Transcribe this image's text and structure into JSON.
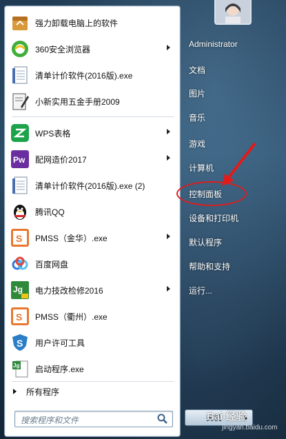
{
  "programs": [
    {
      "label": "强力卸载电脑上的软件",
      "icon": "uninstaller-box-icon",
      "submenu": false
    },
    {
      "label": "360安全浏览器",
      "icon": "360-browser-icon",
      "submenu": true
    },
    {
      "label": "清单计价软件(2016版).exe",
      "icon": "document-exe-icon",
      "submenu": false
    },
    {
      "label": "小新实用五金手册2009",
      "icon": "notebook-pen-icon",
      "submenu": false
    },
    {
      "label": "WPS表格",
      "icon": "wps-spreadsheet-icon",
      "submenu": true
    },
    {
      "label": "配网造价2017",
      "icon": "pw-purple-icon",
      "submenu": true
    },
    {
      "label": "清单计价软件(2016版).exe (2)",
      "icon": "document-exe-icon",
      "submenu": false
    },
    {
      "label": "腾讯QQ",
      "icon": "qq-penguin-icon",
      "submenu": false
    },
    {
      "label": "PMSS（金华）.exe",
      "icon": "pmss-orange-icon",
      "submenu": true
    },
    {
      "label": "百度网盘",
      "icon": "baidu-cloud-icon",
      "submenu": false
    },
    {
      "label": "电力技改检修2016",
      "icon": "jg-green-icon",
      "submenu": true
    },
    {
      "label": "PMSS（衢州）.exe",
      "icon": "pmss-orange-icon",
      "submenu": false
    },
    {
      "label": "用户许可工具",
      "icon": "shield-s-icon",
      "submenu": false
    },
    {
      "label": "启动程序.exe",
      "icon": "jg-doc-icon",
      "submenu": false
    }
  ],
  "all_programs_label": "所有程序",
  "search": {
    "placeholder": "搜索程序和文件"
  },
  "right_pane": [
    {
      "key": "user",
      "label": "Administrator"
    },
    {
      "key": "documents",
      "label": "文档"
    },
    {
      "key": "pictures",
      "label": "图片"
    },
    {
      "key": "music",
      "label": "音乐"
    },
    {
      "key": "games",
      "label": "游戏"
    },
    {
      "key": "computer",
      "label": "计算机"
    },
    {
      "key": "control_panel",
      "label": "控制面板"
    },
    {
      "key": "devices_printers",
      "label": "设备和打印机"
    },
    {
      "key": "default_programs",
      "label": "默认程序"
    },
    {
      "key": "help_support",
      "label": "帮助和支持"
    },
    {
      "key": "run",
      "label": "运行..."
    }
  ],
  "shutdown_label": "关机",
  "watermark": {
    "main": "Bai 经验",
    "sub": "jingyan.baidu.com"
  },
  "colors": {
    "highlight_ellipse": "#e11b1b",
    "arrow": "#e11b1b"
  }
}
